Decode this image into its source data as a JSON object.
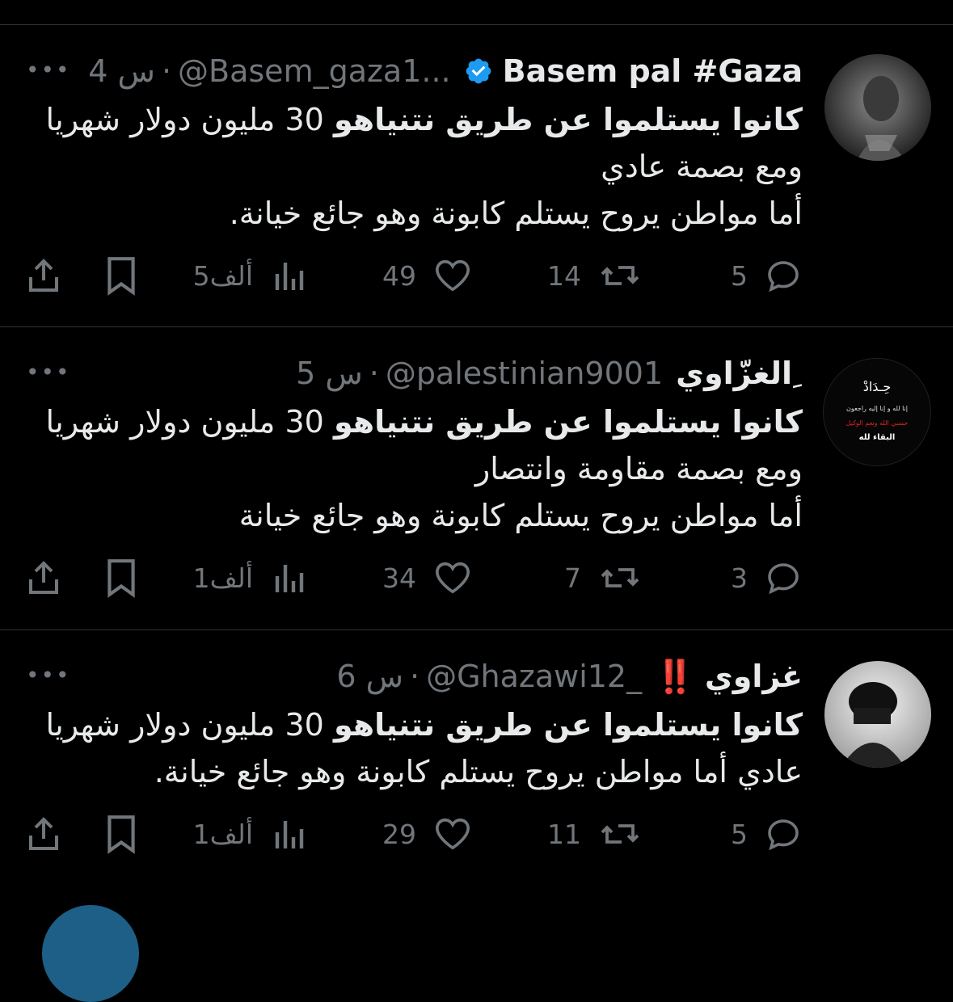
{
  "tweets": [
    {
      "name": "Basem pal #Gaza",
      "handle": "@Basem_gaza1...",
      "time": "4 س",
      "verified": true,
      "line1_bold": "كانوا يستلموا عن طريق نتنياهو",
      "line1_rest": " 30 مليون دولار شهريا",
      "line2": "ومع بصمة عادي",
      "line3": "أما مواطن يروح يستلم كابونة وهو جائع خيانة.",
      "replies": "5",
      "retweets": "14",
      "likes": "49",
      "views": "5ألف"
    },
    {
      "name": "الغزّاوي ِ",
      "handle": "@palestinian9001",
      "time": "5 س",
      "line1_bold": "كانوا يستلموا عن طريق نتنياهو",
      "line1_rest": " 30 مليون دولار شهريا",
      "line2": "ومع بصمة مقاومة وانتصار",
      "line3": "أما مواطن يروح يستلم كابونة وهو جائع خيانة",
      "avatar_text": {
        "title": "حِـدَادْ",
        "verse": "إنا لله و إنا إليه راجعون",
        "red_line": "حسبي الله ونعم الوكيل",
        "bottom": "البقاء لله"
      },
      "replies": "3",
      "retweets": "7",
      "likes": "34",
      "views": "1ألف"
    },
    {
      "name": "غزاوي",
      "badge": "‼️",
      "handle": "@Ghazawi12_",
      "time": "6 س",
      "line1_bold": "كانوا يستلموا عن طريق نتنياهو",
      "line1_rest": " 30 مليون دولار شهريا",
      "line2": "عادي أما مواطن يروح يستلم كابونة وهو جائع خيانة.",
      "replies": "5",
      "retweets": "11",
      "likes": "29",
      "views": "1ألف"
    }
  ],
  "colors": {
    "background": "#000000",
    "text": "#e7e9ea",
    "muted": "#71767b",
    "verified": "#1d9bf0",
    "divider": "#2f3336"
  }
}
